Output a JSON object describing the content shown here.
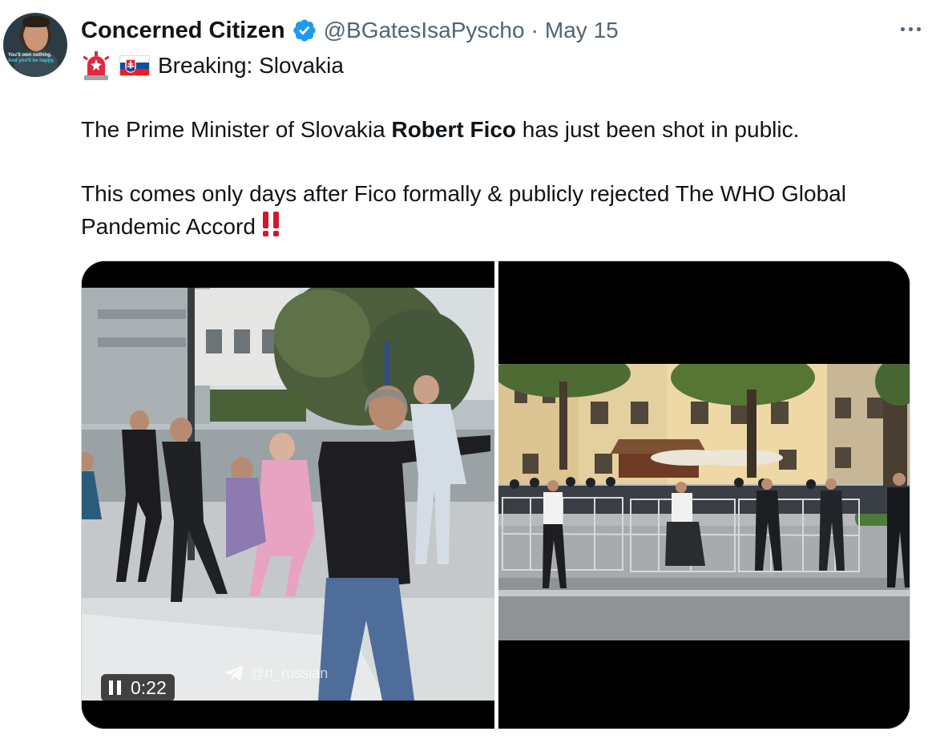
{
  "tweet": {
    "author": {
      "display_name": "Concerned Citizen",
      "handle": "@BGatesIsaPyscho",
      "verified": true,
      "avatar_caption_line1": "You'll own nothing.",
      "avatar_caption_line2": "And you'll be happy."
    },
    "separator": "·",
    "date": "May 15",
    "more_icon": "more-horizontal-icon",
    "line1_emoji": [
      "police-siren-icon",
      "slovakia-flag-icon"
    ],
    "line1_text": "Breaking: Slovakia",
    "paragraph1": {
      "before": "The Prime Minister of Slovakia ",
      "bold": "Robert Fico",
      "after": " has just been shot in public."
    },
    "paragraph2": "This comes only days after Fico formally & publicly rejected The WHO Global Pandemic Accord",
    "paragraph2_emoji": "double-exclamation-icon",
    "media": {
      "left_video": {
        "duration": "0:22",
        "state_icon": "pause-icon",
        "watermark": "@rt_russian"
      },
      "right_image": {
        "description_icon": "photo-icon"
      }
    },
    "colors": {
      "text": "#0f1419",
      "secondary": "#536471",
      "verified_blue": "#1d9bf0",
      "bang_red": "#d0182a"
    }
  }
}
